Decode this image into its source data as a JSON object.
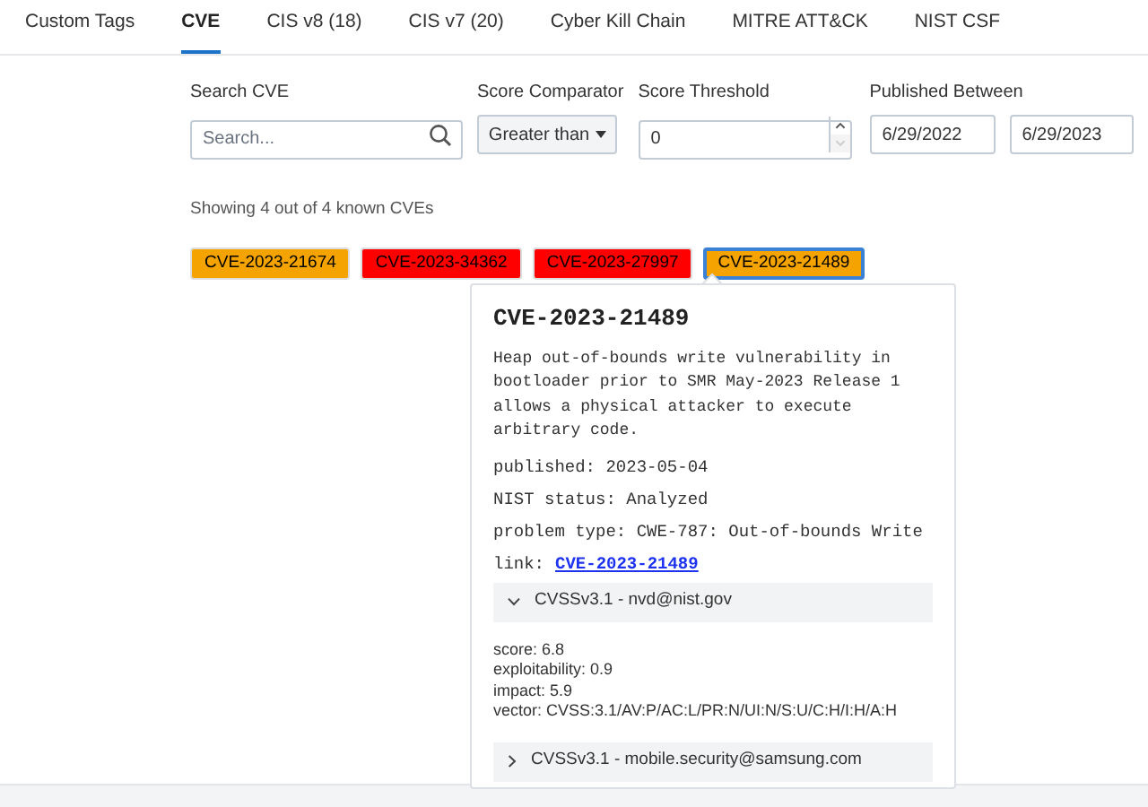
{
  "tabs": [
    {
      "label": "Custom Tags",
      "selected": false
    },
    {
      "label": "CVE",
      "selected": true
    },
    {
      "label": "CIS v8 (18)",
      "selected": false
    },
    {
      "label": "CIS v7 (20)",
      "selected": false
    },
    {
      "label": "Cyber Kill Chain",
      "selected": false
    },
    {
      "label": "MITRE ATT&CK",
      "selected": false
    },
    {
      "label": "NIST CSF",
      "selected": false
    }
  ],
  "filters": {
    "search": {
      "label": "Search CVE",
      "placeholder": "Search..."
    },
    "comparator": {
      "label": "Score Comparator",
      "value": "Greater than"
    },
    "threshold": {
      "label": "Score Threshold",
      "value": "0"
    },
    "published": {
      "label": "Published Between",
      "from": "6/29/2022",
      "to": "6/29/2023"
    }
  },
  "summary": "Showing 4 out of 4 known CVEs",
  "cves": [
    {
      "id": "CVE-2023-21674",
      "color": "#f5a300",
      "selected": false
    },
    {
      "id": "CVE-2023-34362",
      "color": "#ff0000",
      "selected": false
    },
    {
      "id": "CVE-2023-27997",
      "color": "#ff0000",
      "selected": false
    },
    {
      "id": "CVE-2023-21489",
      "color": "#f5a300",
      "selected": true
    }
  ],
  "popover": {
    "title": "CVE-2023-21489",
    "description": "Heap out-of-bounds write vulnerability in bootloader prior to SMR May-2023 Release 1 allows a physical attacker to execute arbitrary code.",
    "fields": [
      "published: 2023-05-04",
      "NIST status: Analyzed",
      "problem type: CWE-787: Out-of-bounds Write"
    ],
    "link_label": "link:",
    "link": "CVE-2023-21489",
    "accordions": [
      {
        "title": "CVSSv3.1 - nvd@nist.gov",
        "expanded": true,
        "lines": [
          "score: 6.8",
          "exploitability: 0.9",
          "impact: 5.9",
          "vector: CVSS:3.1/AV:P/AC:L/PR:N/UI:N/S:U/C:H/I:H/A:H"
        ]
      },
      {
        "title": "CVSSv3.1 - mobile.security@samsung.com",
        "expanded": false
      }
    ]
  }
}
